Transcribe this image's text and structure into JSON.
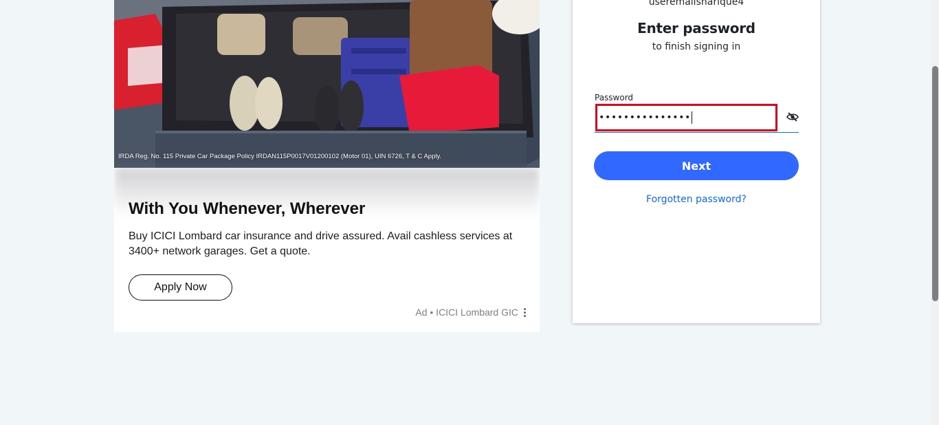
{
  "ad": {
    "disclaimer": "IRDA Reg. No. 115  Private Car Package Policy IRDAN115P0017V01200102 (Motor 01), UIN 6726, T & C Apply.",
    "title": "With You Whenever, Wherever",
    "body": "Buy ICICI Lombard car insurance and drive assured. Avail cashless services at 3400+ network garages. Get a quote.",
    "cta_label": "Apply Now",
    "attribution": "Ad • ICICI Lombard GIC",
    "menu_icon": "kebab-menu-icon"
  },
  "login": {
    "username": "useremailsharique4",
    "heading": "Enter password",
    "subheading": "to finish signing in",
    "password_label": "Password",
    "password_masked": "•••••••••••••••",
    "toggle_icon": "eye-slash-icon",
    "next_label": "Next",
    "forgot_label": "Forgotten password?"
  },
  "colors": {
    "page_bg": "#f1f6f9",
    "primary": "#3168ff",
    "link": "#0f69ff",
    "error_border": "#e0071a"
  }
}
